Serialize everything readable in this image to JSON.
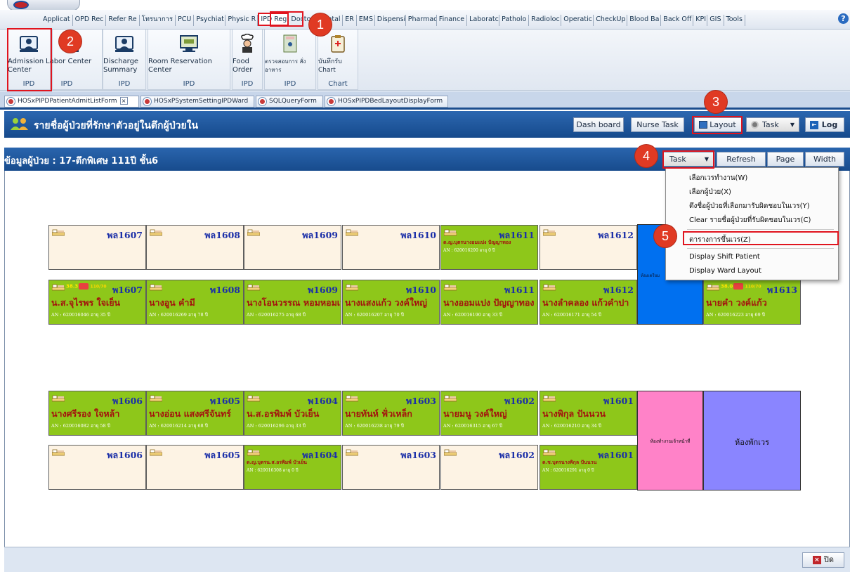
{
  "menu": {
    "items": [
      "Applicat",
      "OPD Rec",
      "Refer Re",
      "โทรนาการ",
      "PCU",
      "Psychiat",
      "Physic R",
      "IPD Regi",
      "Doctor",
      "Dental",
      "ER",
      "EMS",
      "Dispensi",
      "Pharmac",
      "Finance",
      "Laboratc",
      "Patholo",
      "Radioloc",
      "Operatic",
      "CheckUp",
      "Blood Ba",
      "Back Off",
      "KPI",
      "GIS",
      "Tools"
    ],
    "active": "IPD Regi"
  },
  "ribbon": {
    "buttons": [
      {
        "label": "Admission Center",
        "group": "IPD"
      },
      {
        "label": "Labor Center",
        "group": "IPD"
      },
      {
        "label": "Discharge Summary",
        "group": "IPD"
      },
      {
        "label": "Room Reservation Center",
        "group": "IPD"
      },
      {
        "label": "Food Order",
        "group": "IPD"
      },
      {
        "label": "ตรวจสอบการ สั่งอาหาร",
        "group": "IPD"
      },
      {
        "label": "บันทึกรับ Chart",
        "group": "Chart"
      }
    ]
  },
  "tabs": [
    {
      "label": "HOSxPIPDPatientAdmitListForm",
      "active": true
    },
    {
      "label": "HOSxPSystemSettingIPDWard",
      "active": false
    },
    {
      "label": "SQLQueryForm",
      "active": false
    },
    {
      "label": "HOSxPIPDBedLayoutDisplayForm",
      "active": false
    }
  ],
  "tab_close_glyph": "×",
  "header": {
    "title": "รายชื่อผู้ป่วยที่รักษาตัวอยู่ในตึกผู้ป่วยใน",
    "buttons": [
      "Dash board",
      "Nurse Task",
      "Layout",
      "Task",
      "Log"
    ]
  },
  "section": {
    "title": "ข้อมูลผู้ป่วย : 17-ตึกพิเศษ 111ปี ชั้น6",
    "buttons": [
      "Task",
      "Refresh",
      "Page",
      "Width"
    ]
  },
  "dropdown": {
    "items": [
      "เลือกเวรทำงาน(W)",
      "เลือกผู้ป่วย(X)",
      "ดึงชื่อผู้ป่วยที่เลือกมารับผิดชอบในเวร(Y)",
      "Clear รายชื่อผู้ป่วยที่รับผิดชอบในเวร(C)",
      "ตารางการขึ้นเวร(Z)",
      "Display Shift Patient",
      "Display Ward Layout"
    ],
    "highlighted_index": 4
  },
  "callouts": [
    "1",
    "2",
    "3",
    "4",
    "5"
  ],
  "beds": {
    "row1": [
      {
        "code": "พล1607",
        "occupied": false
      },
      {
        "code": "พล1608",
        "occupied": false
      },
      {
        "code": "พล1609",
        "occupied": false
      },
      {
        "code": "พล1610",
        "occupied": false
      },
      {
        "code": "พล1611",
        "occupied": true,
        "name": "ด.ญ.บุตรนางอมแปง ปัญญาทอง",
        "an": "AN : 620016200   อายุ 0 ปี"
      },
      {
        "code": "พล1612",
        "occupied": false
      }
    ],
    "row2": [
      {
        "code": "พ1607",
        "occupied": true,
        "name": "น.ส.จุไรพร ใจเย็น",
        "an": "AN : 620016046   อายุ 35 ปี",
        "temp": "38.3",
        "bp": "110/70"
      },
      {
        "code": "พ1608",
        "occupied": true,
        "name": "นางอูน คำมี",
        "an": "AN : 620016269   อายุ 78 ปี"
      },
      {
        "code": "พ1609",
        "occupied": true,
        "name": "นางโอนวรรณ หอมหอมเจริญ",
        "an": "AN : 620016275   อายุ 68 ปี"
      },
      {
        "code": "พ1610",
        "occupied": true,
        "name": "นางแสงแก้ว วงค์ใหญ่",
        "an": "AN : 620016207   อายุ 70 ปี"
      },
      {
        "code": "พ1611",
        "occupied": true,
        "name": "นางออมแปง ปัญญาทอง",
        "an": "AN : 620016190   อายุ 33 ปี"
      },
      {
        "code": "พ1612",
        "occupied": true,
        "name": "นางลำคลอง แก้วคำปา",
        "an": "AN : 620016171   อายุ 54 ปี"
      },
      {
        "code": "พ1613",
        "occupied": true,
        "name": "นายคำ วงค์แก้ว",
        "an": "AN : 620016223   อายุ 69 ปี",
        "temp": "38.0",
        "bp": "110/70"
      }
    ],
    "row3": [
      {
        "code": "พ1606",
        "occupied": true,
        "name": "นางศรีรอง ใจหล้า",
        "an": "AN : 620016082   อายุ 58 ปี"
      },
      {
        "code": "พ1605",
        "occupied": true,
        "name": "นางอ่อน แสงศรีจันทร์",
        "an": "AN : 620016214   อายุ 68 ปี"
      },
      {
        "code": "พ1604",
        "occupied": true,
        "name": "น.ส.อรพิมพ์ บัวเย็น",
        "an": "AN : 620016296   อายุ 33 ปี"
      },
      {
        "code": "พ1603",
        "occupied": true,
        "name": "นายทันห์ ฟั่วเหล็ก",
        "an": "AN : 620016238   อายุ 79 ปี"
      },
      {
        "code": "พ1602",
        "occupied": true,
        "name": "นายมนู วงค์ใหญ่",
        "an": "AN : 620016315   อายุ 67 ปี"
      },
      {
        "code": "พ1601",
        "occupied": true,
        "name": "นางพิกุล ปันนวน",
        "an": "AN : 620016210   อายุ 34 ปี"
      }
    ],
    "row4": [
      {
        "code": "พล1606",
        "occupied": false
      },
      {
        "code": "พล1605",
        "occupied": false
      },
      {
        "code": "พล1604",
        "occupied": true,
        "name": "ด.ญ.บุตรน.ส.อรพิมพ์ บัวเย็น",
        "an": "AN : 620016308   อายุ 0 ปี"
      },
      {
        "code": "พล1603",
        "occupied": false
      },
      {
        "code": "พล1602",
        "occupied": false
      },
      {
        "code": "พล1601",
        "occupied": true,
        "name": "ด.ช.บุตรนางพิกุล ปันนวน",
        "an": "AN : 620016291   อายุ 0 ปี"
      }
    ]
  },
  "rooms": {
    "prep": "ห้องเตรียม",
    "head_nurse": "ห้องทำงานเจ้าหน้าที่",
    "rest": "ห้องพักเวร"
  },
  "footer": {
    "close_label": "ปิด"
  },
  "colors": {
    "occupied_bed": "#8ec71a",
    "empty_bed": "#fdf3e4",
    "bed_code": "#1b2fa8",
    "patient_name": "#a3120e",
    "header_blue": "#1a4e90",
    "callout_red": "#e03a23"
  }
}
